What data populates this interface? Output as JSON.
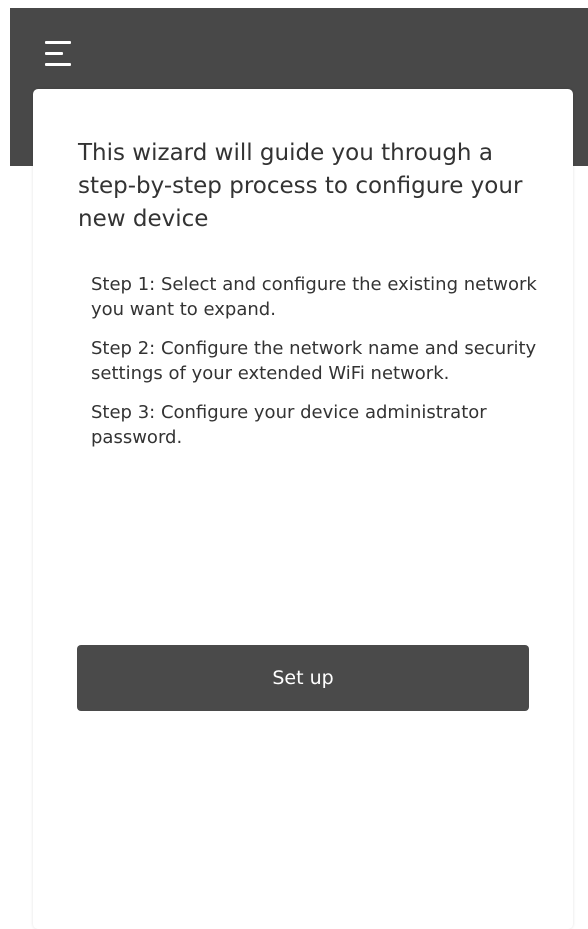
{
  "header": {
    "menu_icon": "hamburger-menu-icon"
  },
  "wizard": {
    "intro": "This wizard will guide you through a step-by-step process to configure your new device",
    "steps": [
      "Step 1: Select and configure the existing network you want to expand.",
      "Step 2: Configure the network name and security settings of your extended WiFi network.",
      "Step 3: Configure your device administrator password."
    ],
    "setup_label": "Set up"
  },
  "colors": {
    "header_bg": "#484848",
    "button_bg": "#4a4a4a",
    "text": "#333333"
  }
}
